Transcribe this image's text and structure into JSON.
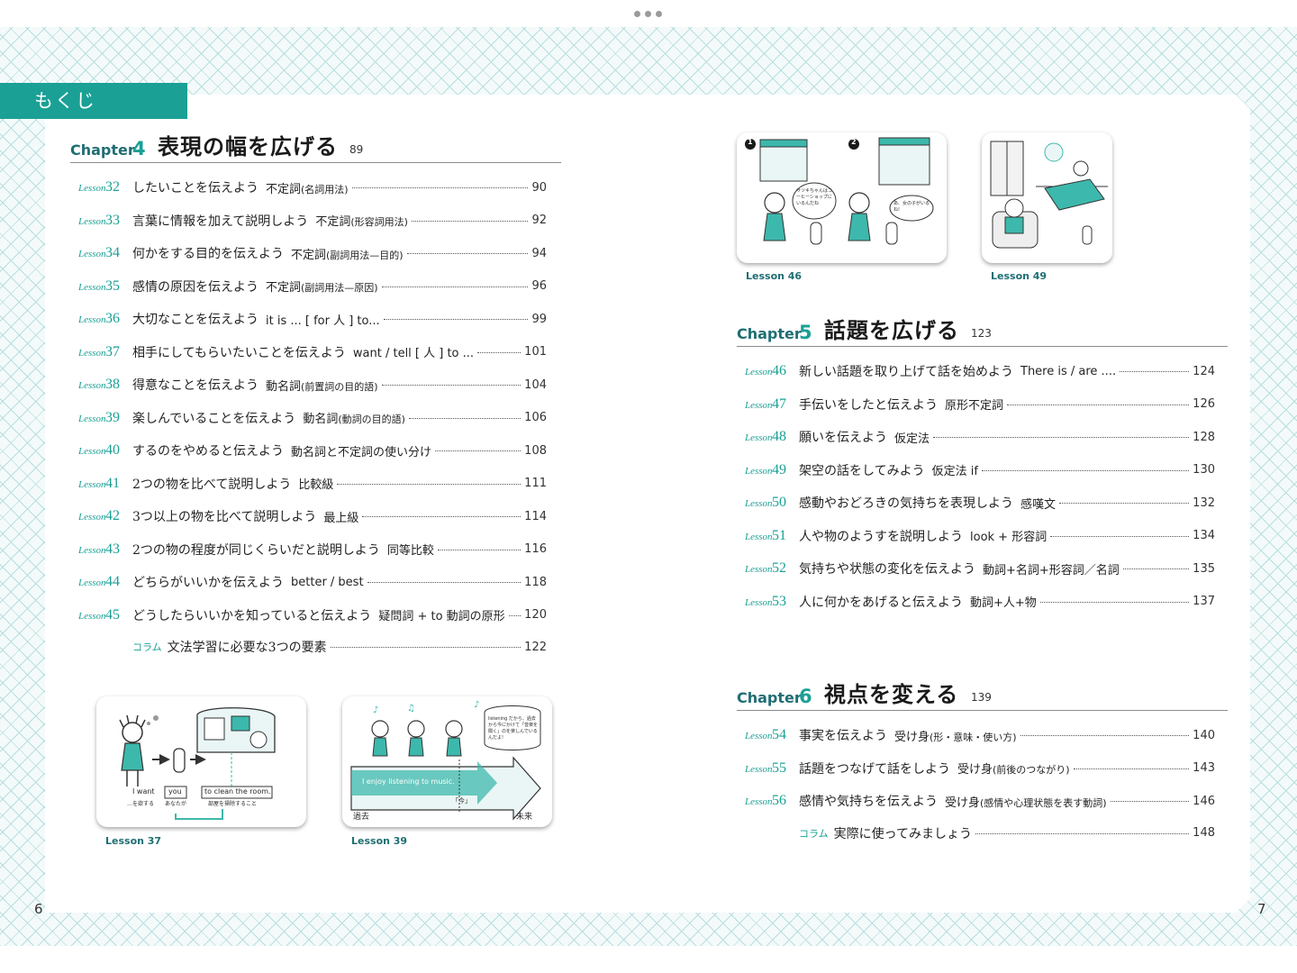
{
  "header": {
    "tag": "もくじ"
  },
  "colors": {
    "accent": "#1aa095",
    "accent_dark": "#1f6e73"
  },
  "chapters": [
    {
      "label": "Chapter",
      "number": "4",
      "title": "表現の幅を広げる",
      "page": "89",
      "entries": [
        {
          "lesson_word": "Lesson",
          "num": "32",
          "title": "したいことを伝えよう",
          "grammar": "不定詞",
          "note": "(名詞用法)",
          "page": "90"
        },
        {
          "lesson_word": "Lesson",
          "num": "33",
          "title": "言葉に情報を加えて説明しよう",
          "grammar": "不定詞",
          "note": "(形容詞用法)",
          "page": "92"
        },
        {
          "lesson_word": "Lesson",
          "num": "34",
          "title": "何かをする目的を伝えよう",
          "grammar": "不定詞",
          "note": "(副詞用法—目的)",
          "page": "94"
        },
        {
          "lesson_word": "Lesson",
          "num": "35",
          "title": "感情の原因を伝えよう",
          "grammar": "不定詞",
          "note": "(副詞用法—原因)",
          "page": "96"
        },
        {
          "lesson_word": "Lesson",
          "num": "36",
          "title": "大切なことを伝えよう",
          "grammar": "it is ... [ for 人 ] to...",
          "note": "",
          "page": "99"
        },
        {
          "lesson_word": "Lesson",
          "num": "37",
          "title": "相手にしてもらいたいことを伝えよう",
          "grammar": "want / tell [ 人 ] to ...",
          "note": "",
          "page": "101"
        },
        {
          "lesson_word": "Lesson",
          "num": "38",
          "title": "得意なことを伝えよう",
          "grammar": "動名詞",
          "note": "(前置詞の目的語)",
          "page": "104"
        },
        {
          "lesson_word": "Lesson",
          "num": "39",
          "title": "楽しんでいることを伝えよう",
          "grammar": "動名詞",
          "note": "(動詞の目的語)",
          "page": "106"
        },
        {
          "lesson_word": "Lesson",
          "num": "40",
          "title": "するのをやめると伝えよう",
          "grammar": "動名詞と不定詞の使い分け",
          "note": "",
          "page": "108"
        },
        {
          "lesson_word": "Lesson",
          "num": "41",
          "title": "2つの物を比べて説明しよう",
          "grammar": "比較級",
          "note": "",
          "page": "111"
        },
        {
          "lesson_word": "Lesson",
          "num": "42",
          "title": "3つ以上の物を比べて説明しよう",
          "grammar": "最上級",
          "note": "",
          "page": "114"
        },
        {
          "lesson_word": "Lesson",
          "num": "43",
          "title": "2つの物の程度が同じくらいだと説明しよう",
          "grammar": "同等比較",
          "note": "",
          "page": "116"
        },
        {
          "lesson_word": "Lesson",
          "num": "44",
          "title": "どちらがいいかを伝えよう",
          "grammar": "better / best",
          "note": "",
          "page": "118"
        },
        {
          "lesson_word": "Lesson",
          "num": "45",
          "title": "どうしたらいいかを知っていると伝えよう",
          "grammar": "疑問詞 + to 動詞の原形",
          "note": "",
          "page": "120"
        }
      ],
      "column": {
        "label": "コラム",
        "title": "文法学習に必要な3つの要素",
        "page": "122"
      }
    },
    {
      "label": "Chapter",
      "number": "5",
      "title": "話題を広げる",
      "page": "123",
      "entries": [
        {
          "lesson_word": "Lesson",
          "num": "46",
          "title": "新しい話題を取り上げて話を始めよう",
          "grammar": "There is / are ....",
          "note": "",
          "page": "124"
        },
        {
          "lesson_word": "Lesson",
          "num": "47",
          "title": "手伝いをしたと伝えよう",
          "grammar": "原形不定詞",
          "note": "",
          "page": "126"
        },
        {
          "lesson_word": "Lesson",
          "num": "48",
          "title": "願いを伝えよう",
          "grammar": "仮定法",
          "note": "",
          "page": "128"
        },
        {
          "lesson_word": "Lesson",
          "num": "49",
          "title": "架空の話をしてみよう",
          "grammar": "仮定法 if",
          "note": "",
          "page": "130"
        },
        {
          "lesson_word": "Lesson",
          "num": "50",
          "title": "感動やおどろきの気持ちを表現しよう",
          "grammar": "感嘆文",
          "note": "",
          "page": "132"
        },
        {
          "lesson_word": "Lesson",
          "num": "51",
          "title": "人や物のようすを説明しよう",
          "grammar": "look + 形容詞",
          "note": "",
          "page": "134"
        },
        {
          "lesson_word": "Lesson",
          "num": "52",
          "title": "気持ちや状態の変化を伝えよう",
          "grammar": "動詞+名詞+形容詞／名詞",
          "note": "",
          "page": "135"
        },
        {
          "lesson_word": "Lesson",
          "num": "53",
          "title": "人に何かをあげると伝えよう",
          "grammar": "動詞+人+物",
          "note": "",
          "page": "137"
        }
      ]
    },
    {
      "label": "Chapter",
      "number": "6",
      "title": "視点を変える",
      "page": "139",
      "entries": [
        {
          "lesson_word": "Lesson",
          "num": "54",
          "title": "事実を伝えよう",
          "grammar": "受け身",
          "note": "(形・意味・使い方)",
          "page": "140"
        },
        {
          "lesson_word": "Lesson",
          "num": "55",
          "title": "話題をつなげて話をしよう",
          "grammar": "受け身",
          "note": "(前後のつながり)",
          "page": "143"
        },
        {
          "lesson_word": "Lesson",
          "num": "56",
          "title": "感情や気持ちを伝えよう",
          "grammar": "受け身",
          "note": "(感情や心理状態を表す動詞)",
          "page": "146"
        }
      ],
      "column": {
        "label": "コラム",
        "title": "実際に使ってみましょう",
        "page": "148"
      }
    }
  ],
  "illustrations": {
    "l37": {
      "caption": "Lesson 37",
      "i_want": "I want",
      "you": "you",
      "to_clean": "to clean the room.",
      "sub1": "…を欲する",
      "sub2": "あなたが",
      "sub3": "部屋を掃除すること"
    },
    "l39": {
      "caption": "Lesson 39",
      "bubble": "listening だから、過去から今にかけて「音楽を聞く」のを楽しんでいるんだよ!",
      "sentence": "I enjoy listening to music.",
      "past": "過去",
      "now": "「今」",
      "future": "未来"
    },
    "l46": {
      "caption": "Lesson 46",
      "n1": "1",
      "n2": "2",
      "bubble1": "サツキちゃんはコーヒーショップにいるんだね",
      "bubble2": "あ、女の子がいるね!"
    },
    "l49": {
      "caption": "Lesson 49"
    }
  },
  "folios": {
    "left": "6",
    "right": "7"
  }
}
